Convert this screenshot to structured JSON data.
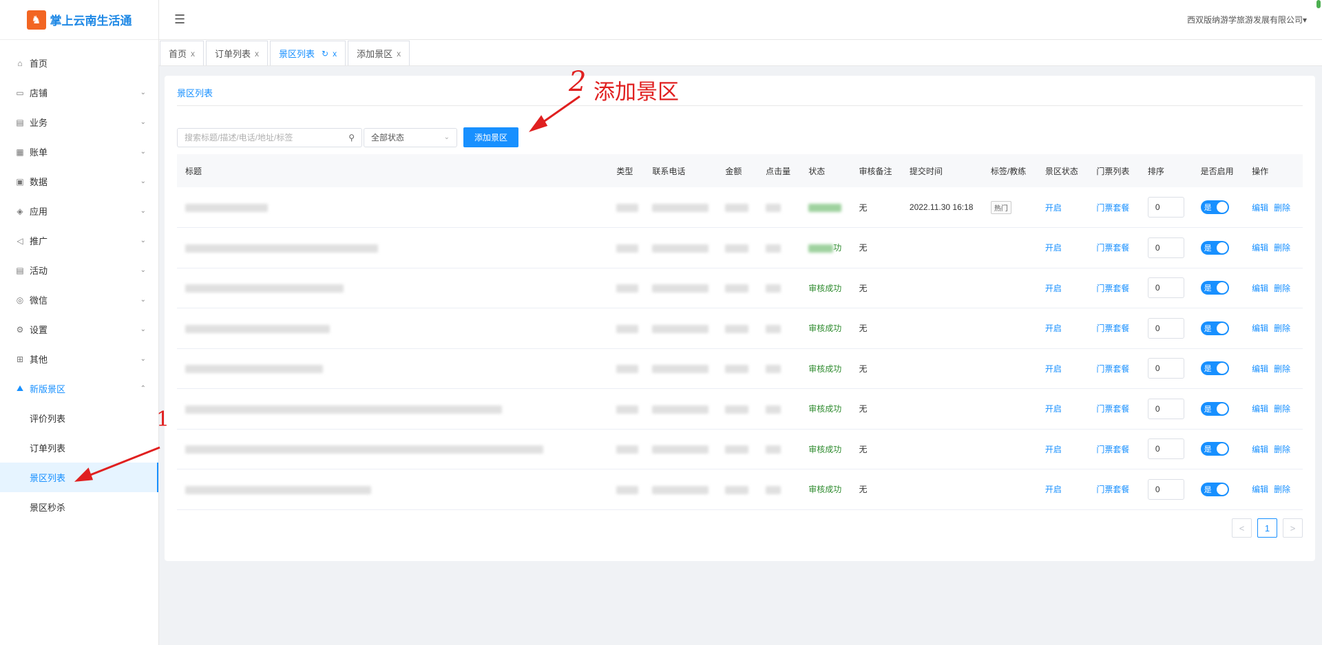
{
  "app": {
    "logo_text": "掌上云南生活通",
    "logo_glyph": "♞",
    "company": "西双版纳游学旅游发展有限公司"
  },
  "sidebar": {
    "items": [
      {
        "label": "首页",
        "icon": "home-icon",
        "glyph": "⌂"
      },
      {
        "label": "店铺",
        "icon": "shop-icon",
        "glyph": "▭"
      },
      {
        "label": "业务",
        "icon": "briefcase-icon",
        "glyph": "▤"
      },
      {
        "label": "账单",
        "icon": "bill-icon",
        "glyph": "▦"
      },
      {
        "label": "数据",
        "icon": "monitor-icon",
        "glyph": "▣"
      },
      {
        "label": "应用",
        "icon": "cube-icon",
        "glyph": "◈"
      },
      {
        "label": "推广",
        "icon": "megaphone-icon",
        "glyph": "◁"
      },
      {
        "label": "活动",
        "icon": "calendar-icon",
        "glyph": "▤"
      },
      {
        "label": "微信",
        "icon": "wechat-icon",
        "glyph": "◎"
      },
      {
        "label": "设置",
        "icon": "gear-icon",
        "glyph": "⚙"
      },
      {
        "label": "其他",
        "icon": "grid-icon",
        "glyph": "⊞"
      },
      {
        "label": "新版景区",
        "icon": "scenic-icon",
        "glyph": "⛰"
      }
    ],
    "sub_items": [
      "评价列表",
      "订单列表",
      "景区列表",
      "景区秒杀"
    ]
  },
  "tabs": [
    {
      "label": "首页"
    },
    {
      "label": "订单列表"
    },
    {
      "label": "景区列表"
    },
    {
      "label": "添加景区"
    }
  ],
  "page": {
    "title": "景区列表",
    "search_placeholder": "搜索标题/描述/电话/地址/标签",
    "status_select": "全部状态",
    "add_button": "添加景区"
  },
  "annotations": {
    "step2_num": "2",
    "step2_text": "添加景区",
    "step1_num": "1"
  },
  "table": {
    "headers": [
      "标题",
      "类型",
      "联系电话",
      "金额",
      "点击量",
      "状态",
      "审核备注",
      "提交时间",
      "标签/教练",
      "景区状态",
      "门票列表",
      "排序",
      "是否启用",
      "操作"
    ],
    "rows": [
      {
        "status": "",
        "note": "无",
        "time": "2022.11.30 16:18",
        "tag": "热门",
        "scenic_status": "开启",
        "tickets": "门票套餐",
        "sort": "0",
        "enabled": "是",
        "edit": "编辑",
        "delete": "删除"
      },
      {
        "status": "功",
        "note": "无",
        "time": "",
        "tag": "",
        "scenic_status": "开启",
        "tickets": "门票套餐",
        "sort": "0",
        "enabled": "是",
        "edit": "编辑",
        "delete": "删除"
      },
      {
        "status": "审核成功",
        "note": "无",
        "time": "",
        "tag": "",
        "scenic_status": "开启",
        "tickets": "门票套餐",
        "sort": "0",
        "enabled": "是",
        "edit": "编辑",
        "delete": "删除"
      },
      {
        "status": "审核成功",
        "note": "无",
        "time": "",
        "tag": "",
        "scenic_status": "开启",
        "tickets": "门票套餐",
        "sort": "0",
        "enabled": "是",
        "edit": "编辑",
        "delete": "删除"
      },
      {
        "status": "审核成功",
        "note": "无",
        "time": "",
        "tag": "",
        "scenic_status": "开启",
        "tickets": "门票套餐",
        "sort": "0",
        "enabled": "是",
        "edit": "编辑",
        "delete": "删除"
      },
      {
        "status": "审核成功",
        "note": "无",
        "time": "",
        "tag": "",
        "scenic_status": "开启",
        "tickets": "门票套餐",
        "sort": "0",
        "enabled": "是",
        "edit": "编辑",
        "delete": "删除"
      },
      {
        "status": "审核成功",
        "note": "无",
        "time": "",
        "tag": "",
        "scenic_status": "开启",
        "tickets": "门票套餐",
        "sort": "0",
        "enabled": "是",
        "edit": "编辑",
        "delete": "删除"
      },
      {
        "status": "审核成功",
        "note": "无",
        "time": "",
        "tag": "",
        "scenic_status": "开启",
        "tickets": "门票套餐",
        "sort": "0",
        "enabled": "是",
        "edit": "编辑",
        "delete": "删除"
      }
    ]
  },
  "pagination": {
    "prev": "<",
    "current": "1",
    "next": ">"
  },
  "colors": {
    "accent": "#1890ff",
    "annotation": "#e02020",
    "success": "#2e8b2e"
  }
}
